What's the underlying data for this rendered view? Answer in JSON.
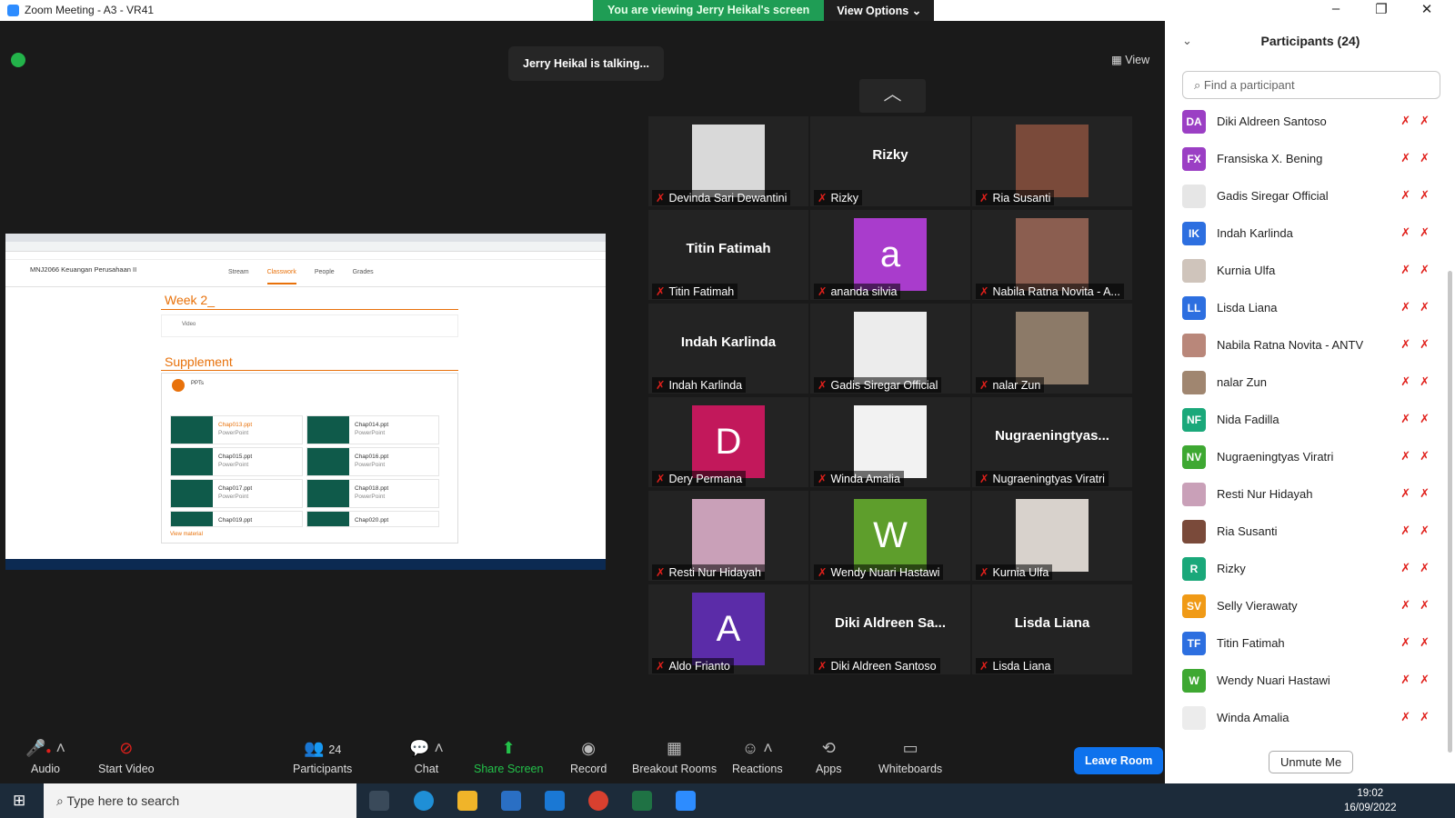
{
  "window": {
    "title": "Zoom Meeting - A3 - VR41"
  },
  "banner": {
    "viewing": "You are viewing Jerry Heikal's screen",
    "view_options": "View Options"
  },
  "meeting": {
    "talking": "Jerry Heikal is talking...",
    "view_label": "View"
  },
  "shared_screen": {
    "course": "MNJ2066 Keuangan Perusahaan II",
    "tabs": [
      "Stream",
      "Classwork",
      "People",
      "Grades"
    ],
    "week": "Week 2_",
    "video": "Video",
    "supplement": "Supplement",
    "ppts": "PPTs",
    "files": [
      {
        "name": "Chap013.ppt",
        "type": "PowerPoint"
      },
      {
        "name": "Chap014.ppt",
        "type": "PowerPoint"
      },
      {
        "name": "Chap015.ppt",
        "type": "PowerPoint"
      },
      {
        "name": "Chap016.ppt",
        "type": "PowerPoint"
      },
      {
        "name": "Chap017.ppt",
        "type": "PowerPoint"
      },
      {
        "name": "Chap018.ppt",
        "type": "PowerPoint"
      },
      {
        "name": "Chap019.ppt",
        "type": ""
      },
      {
        "name": "Chap020.ppt",
        "type": ""
      }
    ],
    "view_material": "View material"
  },
  "gallery": [
    {
      "name": "Devinda Sari Dewantini",
      "kind": "photo",
      "color": "#d9d9d9"
    },
    {
      "name": "Rizky",
      "kind": "text",
      "big": "Rizky"
    },
    {
      "name": "Ria Susanti",
      "kind": "photo",
      "color": "#7a4a3a"
    },
    {
      "name": "Titin Fatimah",
      "kind": "text",
      "big": "Titin Fatimah"
    },
    {
      "name": "ananda silvia",
      "kind": "letter",
      "letter": "a",
      "color": "#a93ccc"
    },
    {
      "name": "Nabila Ratna Novita - A...",
      "kind": "photo",
      "color": "#8b5e50"
    },
    {
      "name": "Indah Karlinda",
      "kind": "text",
      "big": "Indah Karlinda"
    },
    {
      "name": "Gadis Siregar Official",
      "kind": "photo",
      "color": "#ececec"
    },
    {
      "name": "nalar Zun",
      "kind": "photo",
      "color": "#8c7a68"
    },
    {
      "name": "Dery Permana",
      "kind": "letter",
      "letter": "D",
      "color": "#c2185b"
    },
    {
      "name": "Winda Amalia",
      "kind": "photo",
      "color": "#f2f2f2"
    },
    {
      "name": "Nugraeningtyas Viratri",
      "kind": "text",
      "big": "Nugraeningtyas..."
    },
    {
      "name": "Resti Nur Hidayah",
      "kind": "photo",
      "color": "#c9a0b8"
    },
    {
      "name": "Wendy Nuari Hastawi",
      "kind": "letter",
      "letter": "W",
      "color": "#5e9e2c"
    },
    {
      "name": "Kurnia Ulfa",
      "kind": "photo",
      "color": "#d8d2cc"
    },
    {
      "name": "Aldo Frianto",
      "kind": "letter",
      "letter": "A",
      "color": "#5b2ca8"
    },
    {
      "name": "Diki Aldreen Santoso",
      "kind": "text",
      "big": "Diki Aldreen Sa..."
    },
    {
      "name": "Lisda Liana",
      "kind": "text",
      "big": "Lisda Liana"
    }
  ],
  "toolbar": {
    "audio": "Audio",
    "start_video": "Start Video",
    "participants": "Participants",
    "participants_count": "24",
    "chat": "Chat",
    "share_screen": "Share Screen",
    "record": "Record",
    "breakout": "Breakout Rooms",
    "reactions": "Reactions",
    "apps": "Apps",
    "whiteboards": "Whiteboards",
    "leave": "Leave Room"
  },
  "participants_panel": {
    "title": "Participants (24)",
    "search_placeholder": "Find a participant",
    "unmute": "Unmute Me",
    "list": [
      {
        "initials": "DA",
        "name": "Diki Aldreen Santoso",
        "color": "#9b3fc4"
      },
      {
        "initials": "FX",
        "name": "Fransiska X. Bening",
        "color": "#9b3fc4"
      },
      {
        "initials": "",
        "name": "Gadis Siregar Official",
        "color": "#e6e6e6"
      },
      {
        "initials": "IK",
        "name": "Indah Karlinda",
        "color": "#2d6fe0"
      },
      {
        "initials": "",
        "name": "Kurnia Ulfa",
        "color": "#cfc4bb"
      },
      {
        "initials": "LL",
        "name": "Lisda Liana",
        "color": "#2d6fe0"
      },
      {
        "initials": "",
        "name": "Nabila Ratna Novita - ANTV",
        "color": "#b9877a"
      },
      {
        "initials": "",
        "name": "nalar Zun",
        "color": "#a08670"
      },
      {
        "initials": "NF",
        "name": "Nida Fadilla",
        "color": "#1aa87a"
      },
      {
        "initials": "NV",
        "name": "Nugraeningtyas Viratri",
        "color": "#3ea832"
      },
      {
        "initials": "",
        "name": "Resti Nur Hidayah",
        "color": "#c9a0b8"
      },
      {
        "initials": "",
        "name": "Ria Susanti",
        "color": "#7a4a3a"
      },
      {
        "initials": "R",
        "name": "Rizky",
        "color": "#1aa87a"
      },
      {
        "initials": "SV",
        "name": "Selly Vierawaty",
        "color": "#f09a16"
      },
      {
        "initials": "TF",
        "name": "Titin Fatimah",
        "color": "#2d6fe0"
      },
      {
        "initials": "W",
        "name": "Wendy Nuari Hastawi",
        "color": "#3ea832"
      },
      {
        "initials": "",
        "name": "Winda Amalia",
        "color": "#ececec"
      }
    ]
  },
  "taskbar": {
    "search": "Type here to search",
    "time": "19:02",
    "date": "16/09/2022"
  }
}
